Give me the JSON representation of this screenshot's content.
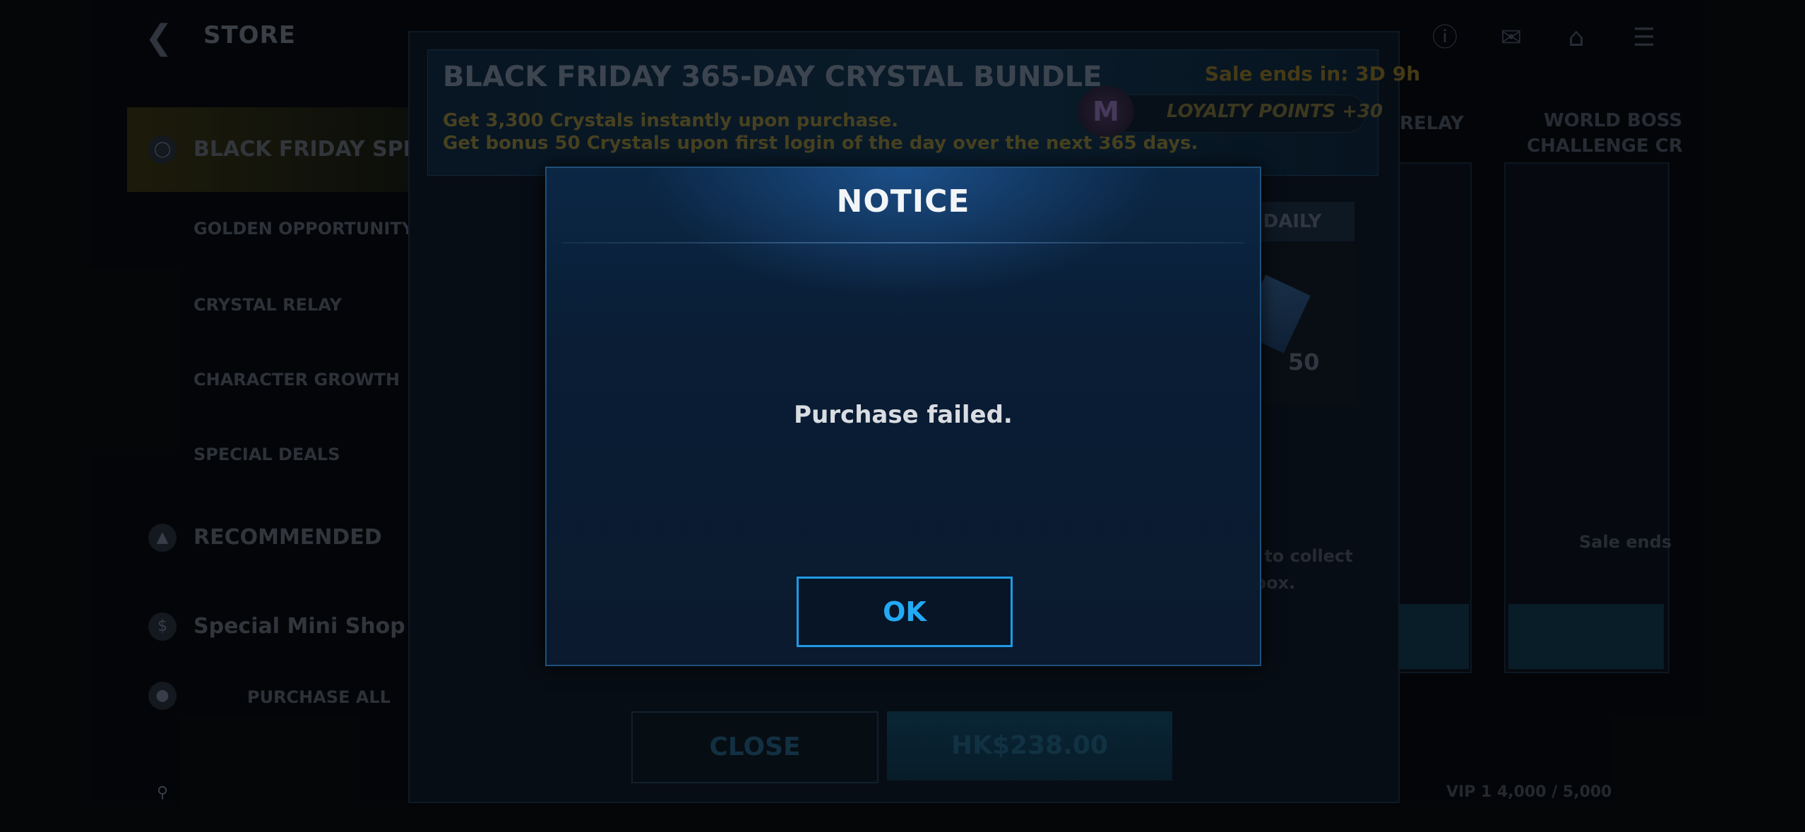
{
  "header": {
    "title": "STORE",
    "back_icon": "back-arrow-icon"
  },
  "sidebar": {
    "items": [
      {
        "label": "BLACK FRIDAY SPECIAL",
        "active": true
      },
      {
        "label": "GOLDEN OPPORTUNITY"
      },
      {
        "label": "CRYSTAL RELAY"
      },
      {
        "label": "CHARACTER GROWTH"
      },
      {
        "label": "SPECIAL DEALS"
      },
      {
        "label": "RECOMMENDED"
      },
      {
        "label": "Special Mini Shop"
      },
      {
        "label": "PURCHASE ALL"
      }
    ]
  },
  "bundle": {
    "title": "BLACK FRIDAY 365-DAY CRYSTAL BUNDLE",
    "desc_line1": "Get 3,300 Crystals instantly upon purchase.",
    "desc_line2": "Get bonus 50 Crystals upon first login of the day over the next 365 days.",
    "sale_ends": "Sale ends in: 3D 9h",
    "loyalty": "LOYALTY POINTS +30",
    "daily_label": "DAILY",
    "daily_count": "50",
    "close_label": "CLOSE",
    "price_label": "HK$238.00"
  },
  "background": {
    "tab_relay": "RELAY",
    "tab_world_boss_1": "WORLD BOSS",
    "tab_world_boss_2": "CHALLENGE CR",
    "collect_1": "ys to collect",
    "collect_2": "box.",
    "sale_ends_short": "Sale ends",
    "vip": "VIP 1  4,000 / 5,000"
  },
  "dialog": {
    "title": "NOTICE",
    "message": "Purchase failed.",
    "ok_label": "OK"
  },
  "colors": {
    "accent": "#22aaf5",
    "dialog_border": "#1f4f7a"
  }
}
